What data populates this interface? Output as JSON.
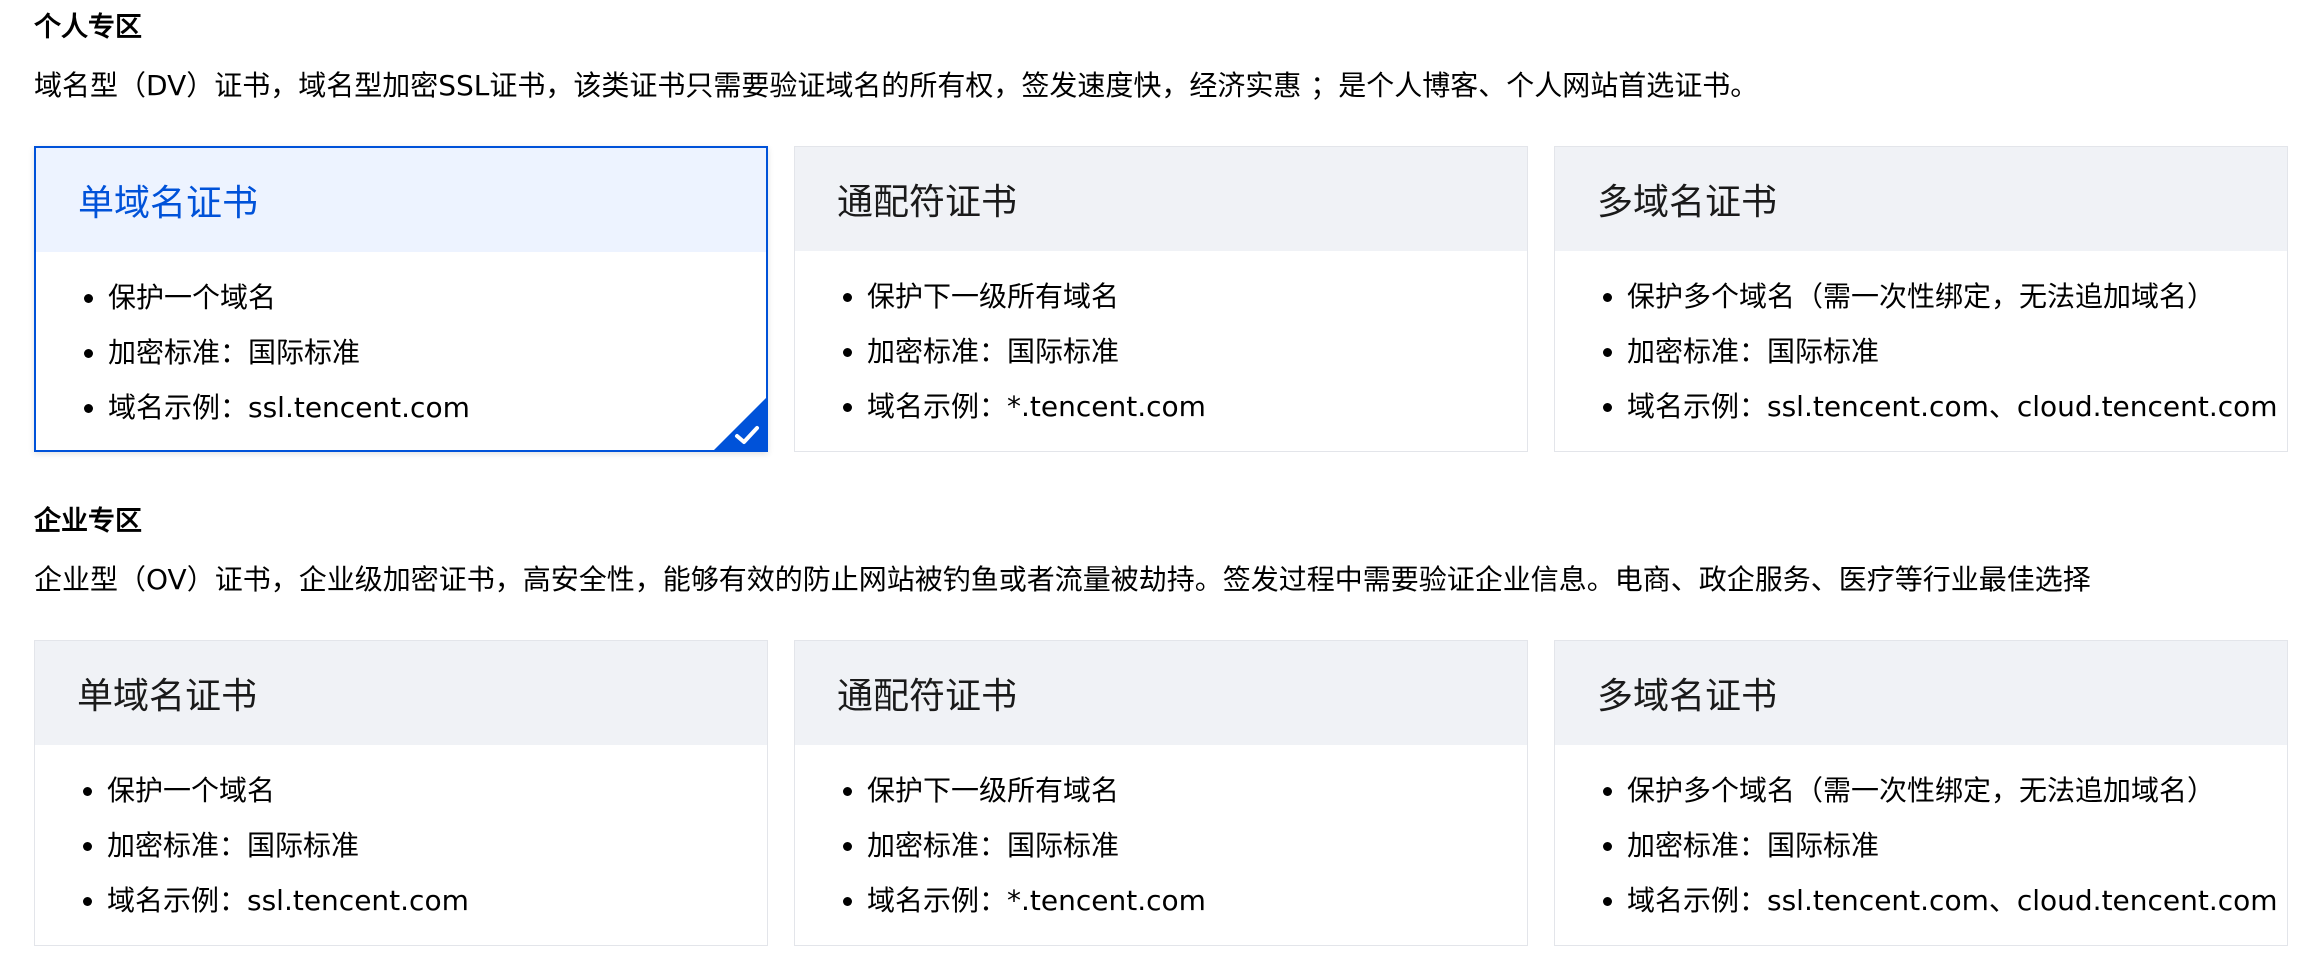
{
  "sections": [
    {
      "title": "个人专区",
      "description": "域名型（DV）证书，域名型加密SSL证书，该类证书只需要验证域名的所有权，签发速度快，经济实惠 ；是个人博客、个人网站首选证书。",
      "cards": [
        {
          "title": "单域名证书",
          "selected": true,
          "features": [
            "保护一个域名",
            "加密标准：国际标准",
            "域名示例：ssl.tencent.com"
          ]
        },
        {
          "title": "通配符证书",
          "selected": false,
          "features": [
            "保护下一级所有域名",
            "加密标准：国际标准",
            "域名示例：*.tencent.com"
          ]
        },
        {
          "title": "多域名证书",
          "selected": false,
          "features": [
            "保护多个域名（需一次性绑定，无法追加域名）",
            "加密标准：国际标准",
            "域名示例：ssl.tencent.com、cloud.tencent.com"
          ]
        }
      ]
    },
    {
      "title": "企业专区",
      "description": "企业型（OV）证书，企业级加密证书，高安全性，能够有效的防止网站被钓鱼或者流量被劫持。签发过程中需要验证企业信息。电商、政企服务、医疗等行业最佳选择",
      "cards": [
        {
          "title": "单域名证书",
          "selected": false,
          "features": [
            "保护一个域名",
            "加密标准：国际标准",
            "域名示例：ssl.tencent.com"
          ]
        },
        {
          "title": "通配符证书",
          "selected": false,
          "features": [
            "保护下一级所有域名",
            "加密标准：国际标准",
            "域名示例：*.tencent.com"
          ]
        },
        {
          "title": "多域名证书",
          "selected": false,
          "features": [
            "保护多个域名（需一次性绑定，无法追加域名）",
            "加密标准：国际标准",
            "域名示例：ssl.tencent.com、cloud.tencent.com"
          ]
        }
      ]
    }
  ],
  "icons": {
    "selected_check": "check-icon"
  },
  "colors": {
    "accent": "#0052d9",
    "card_header_bg": "#f0f2f6",
    "card_header_selected_bg": "#edf3ff",
    "card_border": "#e3e5ea"
  }
}
